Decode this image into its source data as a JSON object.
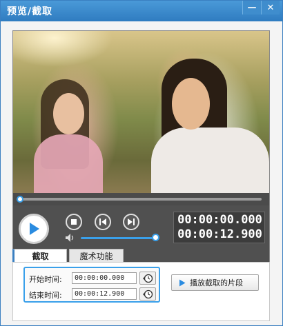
{
  "window": {
    "title": "预览/截取",
    "minimize_glyph": "—",
    "close_glyph": "✕"
  },
  "player": {
    "progress_fraction": 0.0,
    "volume_fraction": 1.0,
    "current_time": "00:00:00.000",
    "total_time": "00:00:12.900"
  },
  "tabs": [
    {
      "label": "截取",
      "active": true
    },
    {
      "label": "魔术功能",
      "active": false
    }
  ],
  "clip": {
    "start_label": "开始时间:",
    "start_value": "00:00:00.000",
    "end_label": "结束时间:",
    "end_value": "00:00:12.900",
    "play_clip_label": "播放截取的片段"
  },
  "colors": {
    "accent": "#3aa0ea",
    "titlebar": "#3a8ad0"
  }
}
